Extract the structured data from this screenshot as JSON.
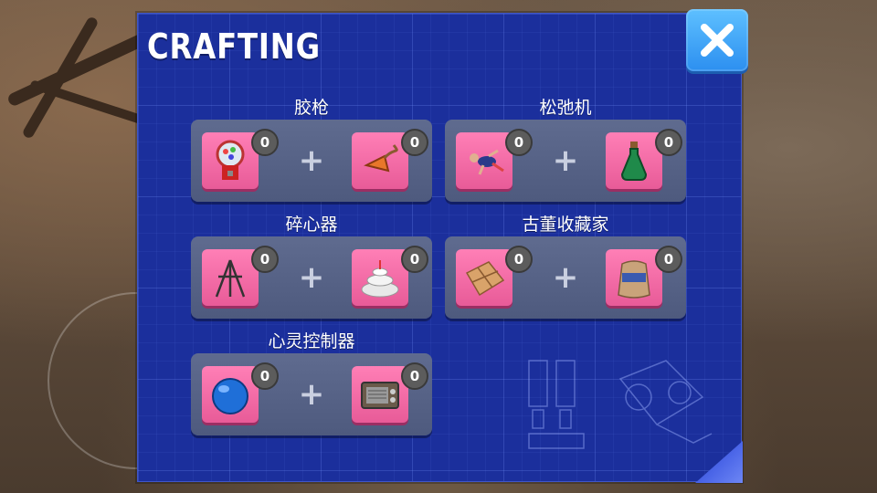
{
  "panel": {
    "title": "CRAFTING",
    "accent_color": "#1b2f9c",
    "close_icon": "close-x-icon"
  },
  "recipes": [
    {
      "name": "胶枪",
      "ingredients": [
        {
          "icon": "gumball-machine-icon",
          "count": "0"
        },
        {
          "icon": "funnel-hose-icon",
          "count": "0"
        }
      ]
    },
    {
      "name": "松弛机",
      "ingredients": [
        {
          "icon": "ragdoll-figure-icon",
          "count": "0"
        },
        {
          "icon": "green-bottle-icon",
          "count": "0"
        }
      ]
    },
    {
      "name": "碎心器",
      "ingredients": [
        {
          "icon": "tripod-stand-icon",
          "count": "0"
        },
        {
          "icon": "layered-cake-icon",
          "count": "0"
        }
      ]
    },
    {
      "name": "古董收藏家",
      "ingredients": [
        {
          "icon": "paper-map-icon",
          "count": "0"
        },
        {
          "icon": "flour-sack-icon",
          "count": "0"
        }
      ]
    },
    {
      "name": "心灵控制器",
      "ingredients": [
        {
          "icon": "blue-ball-icon",
          "count": "0"
        },
        {
          "icon": "old-radio-icon",
          "count": "0"
        }
      ]
    }
  ],
  "plus_symbol": "+"
}
